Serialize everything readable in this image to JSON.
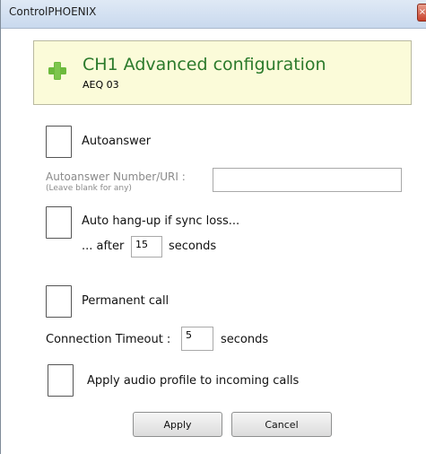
{
  "window": {
    "title": "ControlPHOENIX",
    "close_glyph": "×"
  },
  "header": {
    "title": "CH1 Advanced configuration",
    "subtitle": "AEQ 03",
    "icon": "plus-icon",
    "icon_color": "#6cba3c"
  },
  "autoanswer": {
    "label": "Autoanswer",
    "checked": false,
    "uri_label": "Autoanswer Number/URI :",
    "uri_hint": "(Leave blank for any)",
    "uri_value": ""
  },
  "auto_hangup": {
    "label": "Auto hang-up if sync loss...",
    "checked": false,
    "after_label": "... after",
    "after_value": "15",
    "seconds_label": "seconds"
  },
  "permanent_call": {
    "label": "Permanent call",
    "checked": false
  },
  "connection_timeout": {
    "label": "Connection Timeout :",
    "value": "5",
    "seconds_label": "seconds"
  },
  "audio_profile": {
    "label": "Apply audio profile to incoming calls",
    "checked": false
  },
  "buttons": {
    "apply": "Apply",
    "cancel": "Cancel"
  }
}
